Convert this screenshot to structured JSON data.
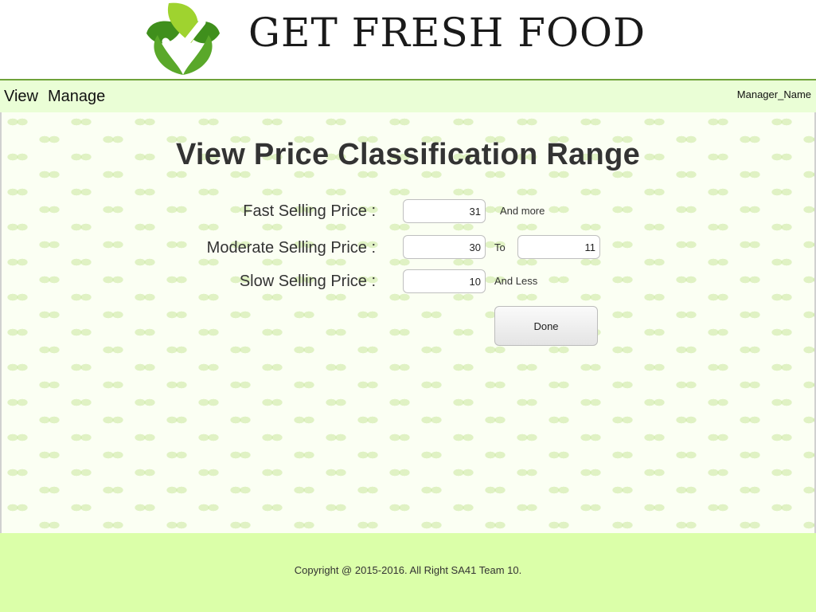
{
  "header": {
    "logo_icon": "leaf-checkmark-icon",
    "logo_text": "GET FRESH FOOD"
  },
  "nav": {
    "items": [
      {
        "label": "View"
      },
      {
        "label": "Manage"
      }
    ],
    "user_name": "Manager_Name"
  },
  "main": {
    "title": "View Price Classification Range",
    "fast": {
      "label": "Fast Selling Price :",
      "value": "31",
      "suffix": "And more"
    },
    "moderate": {
      "label": "Moderate Selling Price :",
      "from_value": "30",
      "to_label": "To",
      "to_value": "11"
    },
    "slow": {
      "label": "Slow Selling Price :",
      "value": "10",
      "suffix": "And Less"
    },
    "done_label": "Done"
  },
  "footer": {
    "copyright": "Copyright @ 2015-2016. All Right SA41 Team 10."
  },
  "colors": {
    "nav_background": "#eafed6",
    "nav_border": "#6fa33a",
    "footer_background": "#dbffa9",
    "brand_green": "#7bbf2a"
  }
}
